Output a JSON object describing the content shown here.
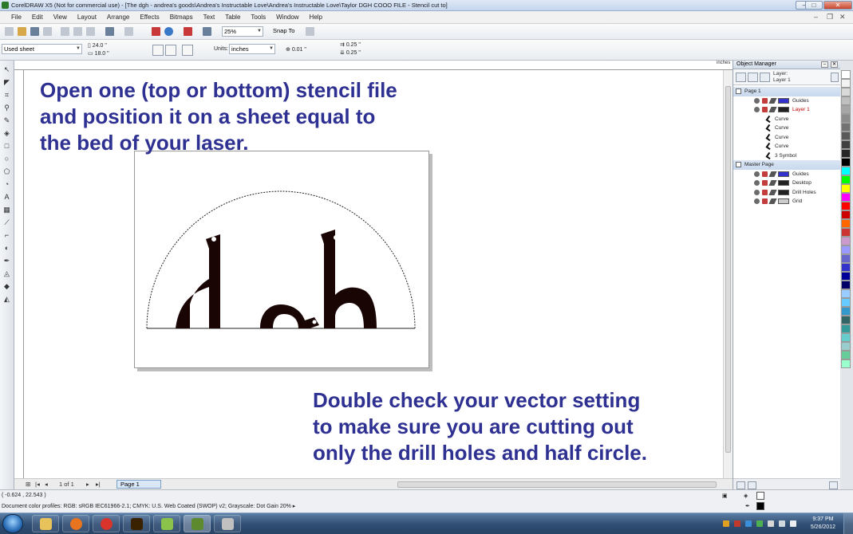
{
  "window": {
    "title": "CorelDRAW X5 (Not for commercial use) - [The dgh - andrea's goods\\Andrea's Instructable Love\\Andrea's Instructable Love\\Taylor DGH COOO FILE - Stencil cut to]",
    "minimize": "–",
    "maximize": "□",
    "close": "✕"
  },
  "menu": {
    "items": [
      "File",
      "Edit",
      "View",
      "Layout",
      "Arrange",
      "Effects",
      "Bitmaps",
      "Text",
      "Table",
      "Tools",
      "Window",
      "Help"
    ],
    "doc_minimize": "–",
    "doc_restore": "❐",
    "doc_close": "✕"
  },
  "standard_toolbar": {
    "zoom": "25%",
    "snap_to": "Snap To"
  },
  "property_bar": {
    "page_size": "Used sheet",
    "width": "24.0 \"",
    "height": "18.0 \"",
    "units_label": "Units:",
    "units": "inches",
    "nudge": "0.01 \"",
    "dup_x": "0.25 \"",
    "dup_y": "0.25 \""
  },
  "ruler": {
    "unit": "inches"
  },
  "captions": {
    "top": "Open one (top or bottom) stencil file\nand position it on a sheet equal to\nthe bed of your laser.",
    "bottom": "Double check your vector setting\nto make sure you are cutting out\nonly the drill holes and half circle."
  },
  "page_nav": {
    "first": "|◂",
    "prev": "◂",
    "page_count": "1 of 1",
    "next": "▸",
    "last": "▸|",
    "add": "⊞",
    "tab": "Page 1"
  },
  "object_manager": {
    "title": "Object Manager",
    "layer_label": "Layer:",
    "layer_value": "Layer 1",
    "tree": [
      {
        "kind": "page",
        "label": "Page 1"
      },
      {
        "kind": "layer",
        "label": "Guides",
        "swatch": "#3333cc"
      },
      {
        "kind": "layer-active",
        "label": "Layer 1",
        "swatch": "#222222"
      },
      {
        "kind": "curve",
        "label": "Curve"
      },
      {
        "kind": "curve",
        "label": "Curve"
      },
      {
        "kind": "curve",
        "label": "Curve"
      },
      {
        "kind": "curve",
        "label": "Curve"
      },
      {
        "kind": "curve",
        "label": "3 Symbol"
      },
      {
        "kind": "page",
        "label": "Master Page"
      },
      {
        "kind": "layer",
        "label": "Guides",
        "swatch": "#3333cc"
      },
      {
        "kind": "layer",
        "label": "Desktop",
        "swatch": "#222222"
      },
      {
        "kind": "layer",
        "label": "Drill Holes",
        "swatch": "#222222"
      },
      {
        "kind": "layer",
        "label": "Grid",
        "swatch": "#cccccc"
      }
    ]
  },
  "palette": [
    "#ffffff",
    "#f2f2f2",
    "#d9d9d9",
    "#bfbfbf",
    "#a6a6a6",
    "#8c8c8c",
    "#737373",
    "#595959",
    "#404040",
    "#262626",
    "#000000",
    "#00ffff",
    "#00ff00",
    "#ffff00",
    "#ff00ff",
    "#ff0000",
    "#cc0000",
    "#ff6600",
    "#cc3333",
    "#cc99cc",
    "#9999ff",
    "#6666cc",
    "#3333cc",
    "#000099",
    "#000066",
    "#99ccff",
    "#66ccff",
    "#3399cc",
    "#336666",
    "#339999",
    "#66cccc",
    "#99cccc",
    "#66cc99",
    "#99ffcc"
  ],
  "status": {
    "coords": "( -0.624 , 22.543 )",
    "object_info": "Document color profiles: RGB: sRGB IEC61966-2.1; CMYK: U.S. Web Coated (SWOP) v2; Grayscale: Dot Gain 20% ▸"
  },
  "taskbar": {
    "clock_time": "9:37 PM",
    "clock_date": "5/26/2012"
  }
}
